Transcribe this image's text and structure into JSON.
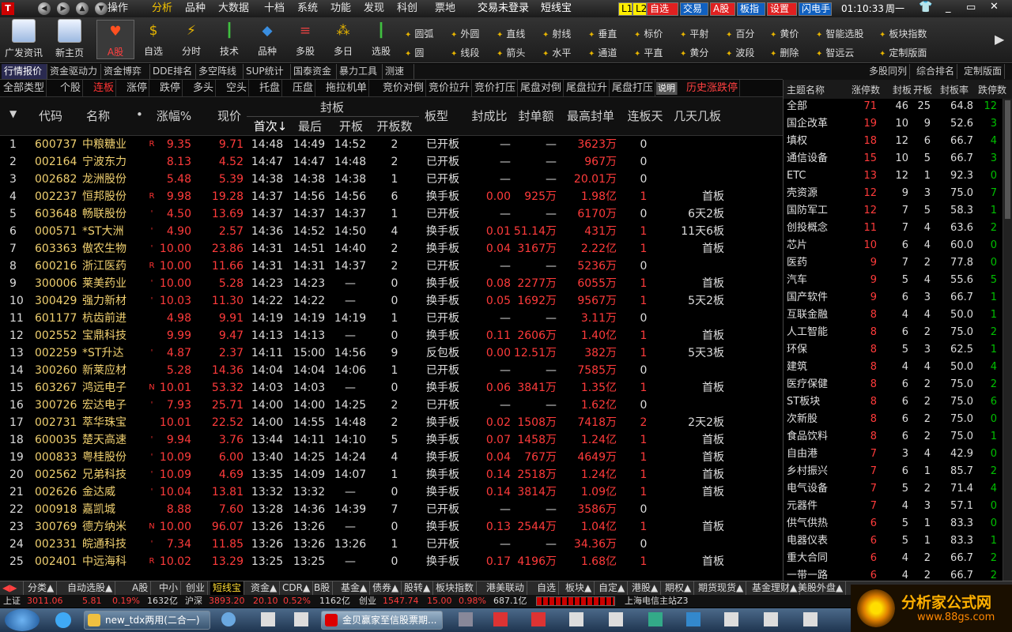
{
  "app": {
    "menu": [
      "操作",
      "分析",
      "品种",
      "大数据",
      "十档",
      "系统",
      "功能",
      "发现",
      "科创",
      "票地"
    ],
    "active_menu": "分析",
    "login_status": "交易未登录",
    "brand": "短线宝",
    "top_buttons": [
      "L1",
      "L2",
      "自选",
      "交易",
      "A股",
      "板指",
      "设置",
      "闪电手"
    ],
    "clock": "01:10:33",
    "weekday": "周一"
  },
  "toolbar": {
    "big_buttons": [
      {
        "label": "广发资讯",
        "icon": "news-icon"
      },
      {
        "label": "新主页",
        "icon": "home-icon"
      },
      {
        "label": "A股",
        "icon": "heart-icon"
      },
      {
        "label": "自选",
        "icon": "star-icon"
      },
      {
        "label": "分时",
        "icon": "lightning-icon"
      },
      {
        "label": "技术",
        "icon": "candlestick-icon"
      },
      {
        "label": "品种",
        "icon": "shapes-icon"
      },
      {
        "label": "多股",
        "icon": "multi-chart-icon"
      },
      {
        "label": "多日",
        "icon": "calendar-icon"
      },
      {
        "label": "选股",
        "icon": "filter-icon"
      }
    ],
    "draw_tools_row1": [
      "圆弧",
      "外圆",
      "直线",
      "射线",
      "垂直",
      "标价",
      "平射",
      "百分",
      "黄价",
      "智能选股",
      "板块指数"
    ],
    "draw_tools_row2": [
      "圆",
      "线段",
      "箭头",
      "水平",
      "通道",
      "平直",
      "黄分",
      "波段",
      "删除",
      "智远云",
      "定制版面"
    ]
  },
  "subtabs": [
    "行情报价",
    "资金驱动力",
    "资金博弈",
    "DDE排名",
    "多空阵线",
    "SUP统计",
    "国泰资金",
    "暴力工具",
    "测速"
  ],
  "side_tabs": [
    "多股同列",
    "综合排名",
    "定制版面"
  ],
  "filter": {
    "items": [
      "全部类型",
      "个股",
      "连板",
      "涨停",
      "跌停",
      "多头",
      "空头",
      "托盘",
      "压盘",
      "拖拉机单",
      "竞价对倒",
      "竞价拉升",
      "竞价打压",
      "尾盘对倒",
      "尾盘拉升",
      "尾盘打压",
      "说明",
      "历史涨跌停"
    ],
    "active": "连板"
  },
  "table": {
    "headers": {
      "code": "代码",
      "name": "名称",
      "chg": "涨幅%",
      "price": "现价",
      "seal": "封板",
      "first": "首次↓",
      "last": "最后",
      "open": "开板",
      "open_count": "开板数",
      "type": "板型",
      "ratio": "封成比",
      "amount": "封单额",
      "max": "最高封单",
      "streak": "连板天",
      "days": "几天几板"
    },
    "rows": [
      {
        "i": "1",
        "code": "600737",
        "name": "中粮糖业",
        "flag": "R",
        "chg": "9.35",
        "price": "9.71",
        "t1": "14:48",
        "t2": "14:49",
        "t3": "14:52",
        "n": "2",
        "type": "已开板",
        "ratio": "—",
        "amt": "—",
        "max": "3623万",
        "streak": "0",
        "days": ""
      },
      {
        "i": "2",
        "code": "002164",
        "name": "宁波东力",
        "flag": "",
        "chg": "8.13",
        "price": "4.52",
        "t1": "14:47",
        "t2": "14:47",
        "t3": "14:48",
        "n": "2",
        "type": "已开板",
        "ratio": "—",
        "amt": "—",
        "max": "967万",
        "streak": "0",
        "days": ""
      },
      {
        "i": "3",
        "code": "002682",
        "name": "龙洲股份",
        "flag": "",
        "chg": "5.48",
        "price": "5.39",
        "t1": "14:38",
        "t2": "14:38",
        "t3": "14:38",
        "n": "1",
        "type": "已开板",
        "ratio": "—",
        "amt": "—",
        "max": "20.01万",
        "streak": "0",
        "days": ""
      },
      {
        "i": "4",
        "code": "002237",
        "name": "恒邦股份",
        "flag": "R",
        "chg": "9.98",
        "price": "19.28",
        "t1": "14:37",
        "t2": "14:56",
        "t3": "14:56",
        "n": "6",
        "type": "换手板",
        "ratio": "0.00",
        "amt": "925万",
        "max": "1.98亿",
        "streak": "1",
        "days": "首板"
      },
      {
        "i": "5",
        "code": "603648",
        "name": "畅联股份",
        "flag": "'",
        "chg": "4.50",
        "price": "13.69",
        "t1": "14:37",
        "t2": "14:37",
        "t3": "14:37",
        "n": "1",
        "type": "已开板",
        "ratio": "—",
        "amt": "—",
        "max": "6170万",
        "streak": "0",
        "days": "6天2板"
      },
      {
        "i": "6",
        "code": "000571",
        "name": "*ST大洲",
        "flag": "'",
        "chg": "4.90",
        "price": "2.57",
        "t1": "14:36",
        "t2": "14:52",
        "t3": "14:50",
        "n": "4",
        "type": "换手板",
        "ratio": "0.01",
        "amt": "51.14万",
        "max": "431万",
        "streak": "1",
        "days": "11天6板"
      },
      {
        "i": "7",
        "code": "603363",
        "name": "傲农生物",
        "flag": "'",
        "chg": "10.00",
        "price": "23.86",
        "t1": "14:31",
        "t2": "14:51",
        "t3": "14:40",
        "n": "2",
        "type": "换手板",
        "ratio": "0.04",
        "amt": "3167万",
        "max": "2.22亿",
        "streak": "1",
        "days": "首板"
      },
      {
        "i": "8",
        "code": "600216",
        "name": "浙江医药",
        "flag": "R",
        "chg": "10.00",
        "price": "11.66",
        "t1": "14:31",
        "t2": "14:31",
        "t3": "14:37",
        "n": "2",
        "type": "已开板",
        "ratio": "—",
        "amt": "—",
        "max": "5236万",
        "streak": "0",
        "days": ""
      },
      {
        "i": "9",
        "code": "300006",
        "name": "莱美药业",
        "flag": "'",
        "chg": "10.00",
        "price": "5.28",
        "t1": "14:23",
        "t2": "14:23",
        "t3": "—",
        "n": "0",
        "type": "换手板",
        "ratio": "0.08",
        "amt": "2277万",
        "max": "6055万",
        "streak": "1",
        "days": "首板"
      },
      {
        "i": "10",
        "code": "300429",
        "name": "强力新材",
        "flag": "'",
        "chg": "10.03",
        "price": "11.30",
        "t1": "14:22",
        "t2": "14:22",
        "t3": "—",
        "n": "0",
        "type": "换手板",
        "ratio": "0.05",
        "amt": "1692万",
        "max": "9567万",
        "streak": "1",
        "days": "5天2板"
      },
      {
        "i": "11",
        "code": "601177",
        "name": "杭齿前进",
        "flag": "",
        "chg": "4.98",
        "price": "9.91",
        "t1": "14:19",
        "t2": "14:19",
        "t3": "14:19",
        "n": "1",
        "type": "已开板",
        "ratio": "—",
        "amt": "—",
        "max": "3.11万",
        "streak": "0",
        "days": ""
      },
      {
        "i": "12",
        "code": "002552",
        "name": "宝鼎科技",
        "flag": "",
        "chg": "9.99",
        "price": "9.47",
        "t1": "14:13",
        "t2": "14:13",
        "t3": "—",
        "n": "0",
        "type": "换手板",
        "ratio": "0.11",
        "amt": "2606万",
        "max": "1.40亿",
        "streak": "1",
        "days": "首板"
      },
      {
        "i": "13",
        "code": "002259",
        "name": "*ST升达",
        "flag": "'",
        "chg": "4.87",
        "price": "2.37",
        "t1": "14:11",
        "t2": "15:00",
        "t3": "14:56",
        "n": "9",
        "type": "反包板",
        "ratio": "0.00",
        "amt": "12.51万",
        "max": "382万",
        "streak": "1",
        "days": "5天3板"
      },
      {
        "i": "14",
        "code": "300260",
        "name": "新莱应材",
        "flag": "",
        "chg": "5.28",
        "price": "14.36",
        "t1": "14:04",
        "t2": "14:04",
        "t3": "14:06",
        "n": "1",
        "type": "已开板",
        "ratio": "—",
        "amt": "—",
        "max": "7585万",
        "streak": "0",
        "days": ""
      },
      {
        "i": "15",
        "code": "603267",
        "name": "鸿远电子",
        "flag": "N",
        "chg": "10.01",
        "price": "53.32",
        "t1": "14:03",
        "t2": "14:03",
        "t3": "—",
        "n": "0",
        "type": "换手板",
        "ratio": "0.06",
        "amt": "3841万",
        "max": "1.35亿",
        "streak": "1",
        "days": "首板"
      },
      {
        "i": "16",
        "code": "300726",
        "name": "宏达电子",
        "flag": "'",
        "chg": "7.93",
        "price": "25.71",
        "t1": "14:00",
        "t2": "14:00",
        "t3": "14:25",
        "n": "2",
        "type": "已开板",
        "ratio": "—",
        "amt": "—",
        "max": "1.62亿",
        "streak": "0",
        "days": ""
      },
      {
        "i": "17",
        "code": "002731",
        "name": "萃华珠宝",
        "flag": "",
        "chg": "10.01",
        "price": "22.52",
        "t1": "14:00",
        "t2": "14:55",
        "t3": "14:48",
        "n": "2",
        "type": "换手板",
        "ratio": "0.02",
        "amt": "1508万",
        "max": "7418万",
        "streak": "2",
        "days": "2天2板"
      },
      {
        "i": "18",
        "code": "600035",
        "name": "楚天高速",
        "flag": "'",
        "chg": "9.94",
        "price": "3.76",
        "t1": "13:44",
        "t2": "14:11",
        "t3": "14:10",
        "n": "5",
        "type": "换手板",
        "ratio": "0.07",
        "amt": "1458万",
        "max": "1.24亿",
        "streak": "1",
        "days": "首板"
      },
      {
        "i": "19",
        "code": "000833",
        "name": "粤桂股份",
        "flag": "'",
        "chg": "10.09",
        "price": "6.00",
        "t1": "13:40",
        "t2": "14:25",
        "t3": "14:24",
        "n": "4",
        "type": "换手板",
        "ratio": "0.04",
        "amt": "767万",
        "max": "4649万",
        "streak": "1",
        "days": "首板"
      },
      {
        "i": "20",
        "code": "002562",
        "name": "兄弟科技",
        "flag": "'",
        "chg": "10.09",
        "price": "4.69",
        "t1": "13:35",
        "t2": "14:09",
        "t3": "14:07",
        "n": "1",
        "type": "换手板",
        "ratio": "0.14",
        "amt": "2518万",
        "max": "1.24亿",
        "streak": "1",
        "days": "首板"
      },
      {
        "i": "21",
        "code": "002626",
        "name": "金达威",
        "flag": "'",
        "chg": "10.04",
        "price": "13.81",
        "t1": "13:32",
        "t2": "13:32",
        "t3": "—",
        "n": "0",
        "type": "换手板",
        "ratio": "0.14",
        "amt": "3814万",
        "max": "1.09亿",
        "streak": "1",
        "days": "首板"
      },
      {
        "i": "22",
        "code": "000918",
        "name": "嘉凯城",
        "flag": "",
        "chg": "8.88",
        "price": "7.60",
        "t1": "13:28",
        "t2": "14:36",
        "t3": "14:39",
        "n": "7",
        "type": "已开板",
        "ratio": "—",
        "amt": "—",
        "max": "3586万",
        "streak": "0",
        "days": ""
      },
      {
        "i": "23",
        "code": "300769",
        "name": "德方纳米",
        "flag": "N",
        "chg": "10.00",
        "price": "96.07",
        "t1": "13:26",
        "t2": "13:26",
        "t3": "—",
        "n": "0",
        "type": "换手板",
        "ratio": "0.13",
        "amt": "2544万",
        "max": "1.04亿",
        "streak": "1",
        "days": "首板"
      },
      {
        "i": "24",
        "code": "002331",
        "name": "皖通科技",
        "flag": "'",
        "chg": "7.34",
        "price": "11.85",
        "t1": "13:26",
        "t2": "13:26",
        "t3": "13:26",
        "n": "1",
        "type": "已开板",
        "ratio": "—",
        "amt": "—",
        "max": "34.36万",
        "streak": "0",
        "days": ""
      },
      {
        "i": "25",
        "code": "002401",
        "name": "中远海科",
        "flag": "R",
        "chg": "10.02",
        "price": "13.29",
        "t1": "13:25",
        "t2": "13:25",
        "t3": "—",
        "n": "0",
        "type": "换手板",
        "ratio": "0.17",
        "amt": "4196万",
        "max": "1.68亿",
        "streak": "1",
        "days": "首板"
      }
    ]
  },
  "side": {
    "headers": [
      "主题名称",
      "涨停数",
      "封板",
      "开板",
      "封板率",
      "跌停数"
    ],
    "rows": [
      [
        "全部",
        "71",
        "46",
        "25",
        "64.8",
        "12"
      ],
      [
        "国企改革",
        "19",
        "10",
        "9",
        "52.6",
        "3"
      ],
      [
        "填权",
        "18",
        "12",
        "6",
        "66.7",
        "4"
      ],
      [
        "通信设备",
        "15",
        "10",
        "5",
        "66.7",
        "3"
      ],
      [
        "ETC",
        "13",
        "12",
        "1",
        "92.3",
        "0"
      ],
      [
        "壳资源",
        "12",
        "9",
        "3",
        "75.0",
        "7"
      ],
      [
        "国防军工",
        "12",
        "7",
        "5",
        "58.3",
        "1"
      ],
      [
        "创投概念",
        "11",
        "7",
        "4",
        "63.6",
        "2"
      ],
      [
        "芯片",
        "10",
        "6",
        "4",
        "60.0",
        "0"
      ],
      [
        "医药",
        "9",
        "7",
        "2",
        "77.8",
        "0"
      ],
      [
        "汽车",
        "9",
        "5",
        "4",
        "55.6",
        "5"
      ],
      [
        "国产软件",
        "9",
        "6",
        "3",
        "66.7",
        "1"
      ],
      [
        "互联金融",
        "8",
        "4",
        "4",
        "50.0",
        "1"
      ],
      [
        "人工智能",
        "8",
        "6",
        "2",
        "75.0",
        "2"
      ],
      [
        "环保",
        "8",
        "5",
        "3",
        "62.5",
        "1"
      ],
      [
        "建筑",
        "8",
        "4",
        "4",
        "50.0",
        "4"
      ],
      [
        "医疗保健",
        "8",
        "6",
        "2",
        "75.0",
        "2"
      ],
      [
        "ST板块",
        "8",
        "6",
        "2",
        "75.0",
        "6"
      ],
      [
        "次新股",
        "8",
        "6",
        "2",
        "75.0",
        "0"
      ],
      [
        "食品饮料",
        "8",
        "6",
        "2",
        "75.0",
        "1"
      ],
      [
        "自由港",
        "7",
        "3",
        "4",
        "42.9",
        "0"
      ],
      [
        "乡村振兴",
        "7",
        "6",
        "1",
        "85.7",
        "2"
      ],
      [
        "电气设备",
        "7",
        "5",
        "2",
        "71.4",
        "4"
      ],
      [
        "元器件",
        "7",
        "4",
        "3",
        "57.1",
        "0"
      ],
      [
        "供气供热",
        "6",
        "5",
        "1",
        "83.3",
        "0"
      ],
      [
        "电器仪表",
        "6",
        "5",
        "1",
        "83.3",
        "1"
      ],
      [
        "重大合同",
        "6",
        "4",
        "2",
        "66.7",
        "2"
      ],
      [
        "一带一路",
        "6",
        "4",
        "2",
        "66.7",
        "2"
      ]
    ]
  },
  "bottom_tabs": [
    "分类▲",
    "自动选股▲",
    "A股",
    "中小",
    "创业",
    "短线宝",
    "资金▲",
    "CDR▲",
    "B股",
    "基金▲",
    "债券▲",
    "股转▲",
    "板块指数",
    "港美联动",
    "自选",
    "板块▲",
    "自定▲",
    "港股▲",
    "期权▲",
    "期货现货▲",
    "基金理财▲",
    "美股外盘▲"
  ],
  "active_bottom_tab": "短线宝",
  "status": {
    "sh": "上证",
    "sh_val": "3011.06",
    "sh_chg": "5.81",
    "sh_pct": "0.19%",
    "sh_amt": "1632亿",
    "hs": "沪深",
    "hs_val": "3893.20",
    "hs_chg": "20.10",
    "hs_pct": "0.52%",
    "hs_amt": "1162亿",
    "cy": "创业",
    "cy_val": "1547.74",
    "cy_chg": "15.00",
    "cy_pct": "0.98%",
    "cy_amt": "687.1亿",
    "server": "上海电信主站Z3"
  },
  "taskbar": {
    "tasks": [
      "new_tdx两用(二合一)",
      "金贝赢家至信股票期..."
    ]
  },
  "watermark": {
    "title": "分析家公式网",
    "url": "www.88gs.com"
  },
  "colors": {
    "up": "#ff3b3b",
    "down": "#00c000",
    "code": "#f0d070",
    "bg": "#000000"
  }
}
